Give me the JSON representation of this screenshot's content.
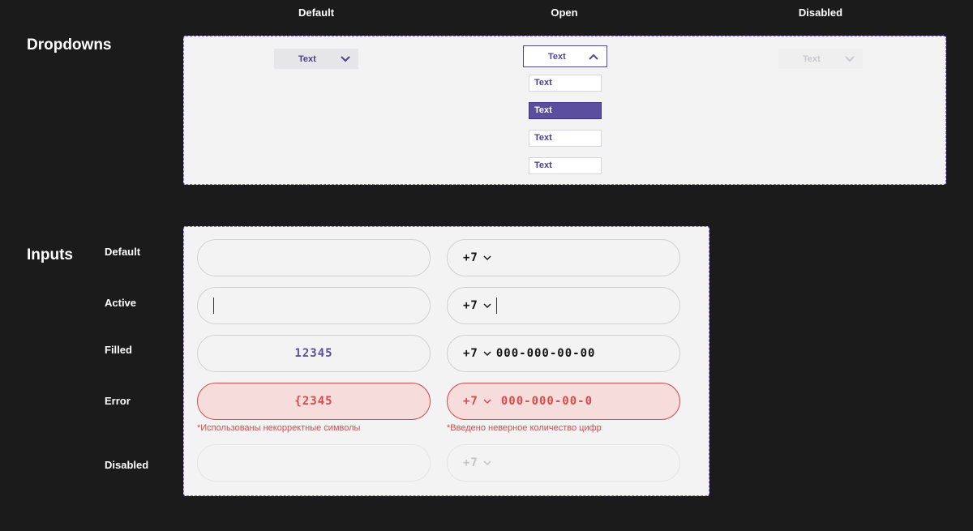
{
  "column_headers": [
    "Default",
    "Open",
    "Disabled"
  ],
  "dropdowns": {
    "title": "Dropdowns",
    "default_label": "Text",
    "open_label": "Text",
    "disabled_label": "Text",
    "options": [
      "Text",
      "Text",
      "Text",
      "Text"
    ],
    "selected_index": 1
  },
  "inputs": {
    "title": "Inputs",
    "rows": [
      "Default",
      "Active",
      "Filled",
      "Error",
      "Disabled"
    ],
    "country_code": "+7",
    "filled_left": "12345",
    "filled_right": "000-000-00-00",
    "error_left": "{2345",
    "error_right": "000-000-00-0",
    "error_left_msg": "*Использованы некорректные символы",
    "error_right_msg": "*Введено неверное количество цифр"
  },
  "colors": {
    "background": "#1c1b1c",
    "accent": "#5c4e9e",
    "error": "#d44c4c",
    "frame_border": "#8c62ff"
  }
}
